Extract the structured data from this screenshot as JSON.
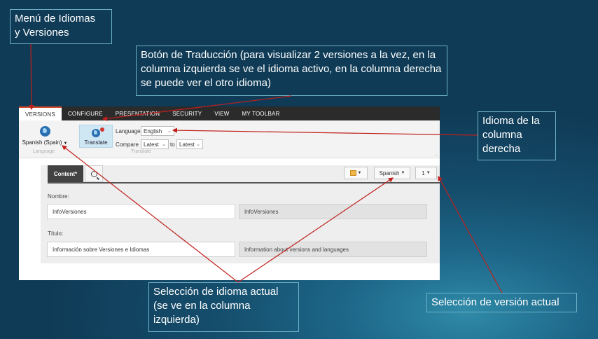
{
  "callouts": {
    "menu": "Menú de Idiomas\ny Versiones",
    "translate": "Botón de Traducción (para visualizar 2 versiones a la vez, en la columna izquierda se ve el idioma activo, en la columna derecha se puede ver el otro idioma)",
    "right_lang": "Idioma de la\ncolumna\nderecha",
    "current_lang": "Selección de idioma actual\n(se ve en la columna\nizquierda)",
    "current_version": "Selección de versión actual"
  },
  "menubar": {
    "tabs": [
      "VERSIONS",
      "CONFIGURE",
      "PRESENTATION",
      "SECURITY",
      "VIEW",
      "MY TOOLBAR"
    ],
    "active": "VERSIONS"
  },
  "ribbon": {
    "language_button": "Spanish (Spain)",
    "language_group": "Language",
    "translate_button": "Translate",
    "translate_group": "Translate",
    "language_label": "Language",
    "language_value": "English",
    "compare_label": "Compare",
    "compare_from": "Latest",
    "to_label": "to",
    "compare_to": "Latest"
  },
  "editor": {
    "tab_content": "Content*",
    "language_select": "Spanish",
    "version_select": "1",
    "fields": [
      {
        "label": "Nombre:",
        "left": "InfoVersiones",
        "right": "InfoVersiones"
      },
      {
        "label": "Título:",
        "left": "Información sobre Versiones e Idiomas",
        "right": "Information about versions and languages"
      }
    ]
  },
  "colors": {
    "accent": "#d84b2a",
    "arrow": "#c0201c",
    "menubar": "#2b2b2b",
    "callout_border": "#6fb3c8"
  },
  "icons": [
    "globe-icon",
    "translate-globe-icon",
    "search-icon",
    "chevron-down-icon",
    "notification-dot-icon"
  ]
}
